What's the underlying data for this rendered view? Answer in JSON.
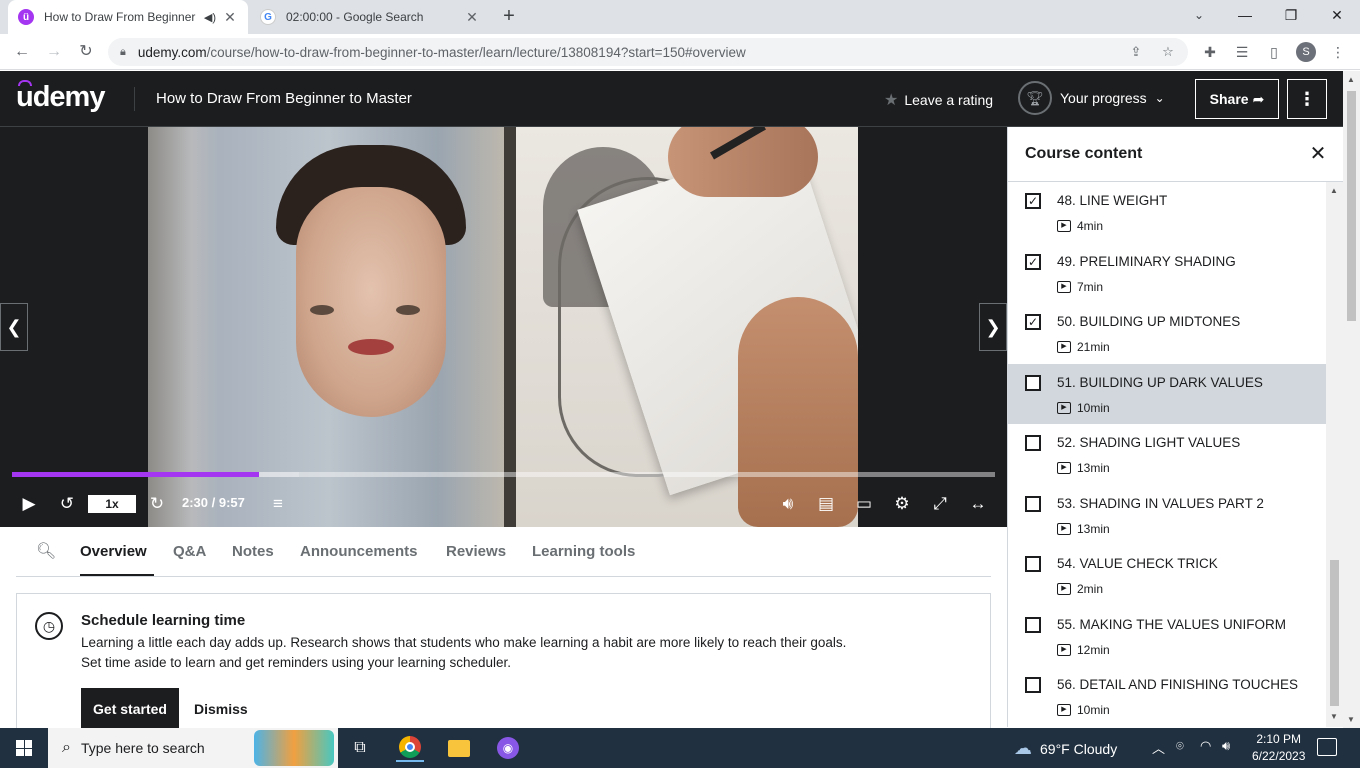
{
  "browser": {
    "tabs": [
      {
        "title": "How to Draw From Beginner",
        "favicon": "udemy-icon",
        "active": true
      },
      {
        "title": "02:00:00 - Google Search",
        "favicon": "google-icon",
        "active": false
      }
    ],
    "url_host": "udemy.com",
    "url_path": "/course/how-to-draw-from-beginner-to-master/learn/lecture/13808194?start=150#overview",
    "profile_initial": "S"
  },
  "header": {
    "logo": "udemy",
    "course_title": "How to Draw From Beginner to Master",
    "rating_label": "Leave a rating",
    "progress_label": "Your progress",
    "share_label": "Share",
    "accent_color": "#a435f0"
  },
  "player": {
    "progress_fraction": 0.251,
    "buffer_fraction": 0.292,
    "speed_label": "1x",
    "time_label": "2:30 / 9:57"
  },
  "content_tabs": [
    "Overview",
    "Q&A",
    "Notes",
    "Announcements",
    "Reviews",
    "Learning tools"
  ],
  "active_tab": "Overview",
  "schedule": {
    "title": "Schedule learning time",
    "line1": "Learning a little each day adds up. Research shows that students who make learning a habit are more likely to reach their goals.",
    "line2": "Set time aside to learn and get reminders using your learning scheduler.",
    "primary": "Get started",
    "secondary": "Dismiss"
  },
  "sidebar": {
    "title": "Course content",
    "lectures": [
      {
        "title": "48. LINE WEIGHT",
        "duration": "4min",
        "checked": true,
        "current": false
      },
      {
        "title": "49. PRELIMINARY SHADING",
        "duration": "7min",
        "checked": true,
        "current": false
      },
      {
        "title": "50. BUILDING UP MIDTONES",
        "duration": "21min",
        "checked": true,
        "current": false
      },
      {
        "title": "51. BUILDING UP DARK VALUES",
        "duration": "10min",
        "checked": false,
        "current": true
      },
      {
        "title": "52. SHADING LIGHT VALUES",
        "duration": "13min",
        "checked": false,
        "current": false
      },
      {
        "title": "53. SHADING IN VALUES PART 2",
        "duration": "13min",
        "checked": false,
        "current": false
      },
      {
        "title": "54. VALUE CHECK TRICK",
        "duration": "2min",
        "checked": false,
        "current": false
      },
      {
        "title": "55. MAKING THE VALUES UNIFORM",
        "duration": "12min",
        "checked": false,
        "current": false
      },
      {
        "title": "56. DETAIL AND FINISHING TOUCHES",
        "duration": "10min",
        "checked": false,
        "current": false
      }
    ]
  },
  "taskbar": {
    "search_placeholder": "Type here to search",
    "weather": "69°F  Cloudy",
    "time": "2:10 PM",
    "date": "6/22/2023"
  }
}
